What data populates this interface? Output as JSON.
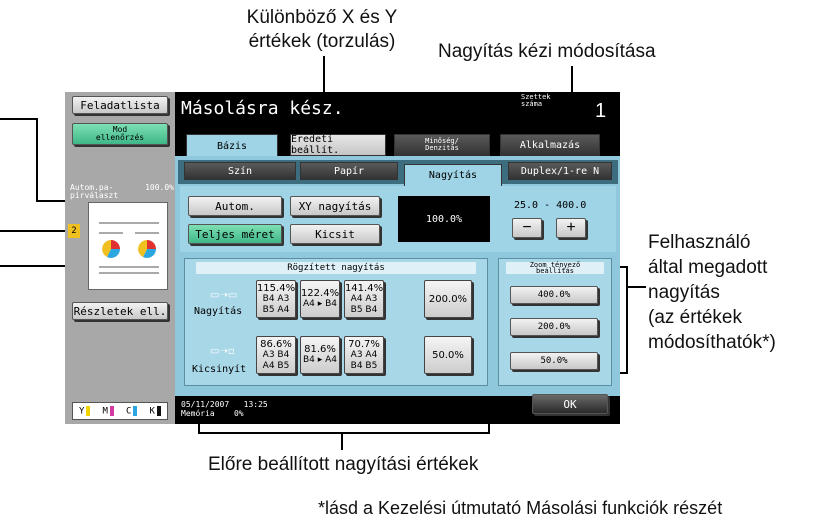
{
  "callouts": {
    "xy_line1": "Különböző X és Y",
    "xy_line2": "értékek (torzulás)",
    "manual": "Nagyítás kézi módosítása",
    "user_line1": "Felhasználó",
    "user_line2": "által megadott",
    "user_line3": "nagyítás",
    "user_line4": "(az értékek",
    "user_line5": "módosíthatók*)",
    "preset": "Előre beállított nagyítási értékek",
    "footnote": "*lásd a Kezelési útmutató Másolási funkciók részét"
  },
  "left": {
    "job_list": "Feladatlista",
    "check_l1": "Mod",
    "check_l2": "ellenőrzés",
    "auto_l1": "Autom.pa-",
    "auto_l2": "pírválaszt",
    "auto_zoom": "100.0%",
    "tray": "2",
    "details": "Részletek ell.",
    "toner": [
      "Y",
      "M",
      "C",
      "K"
    ],
    "toner_colors": [
      "#f2d200",
      "#d43aa6",
      "#2aa6e0",
      "#111111"
    ]
  },
  "header": {
    "status": "Másolásra kész.",
    "sets_l1": "Szettek",
    "sets_l2": "száma",
    "sets_value": "1"
  },
  "tabs": {
    "basic": "Bázis",
    "original": "Eredeti beállít.",
    "quality_l1": "Minőség/",
    "quality_l2": "Denzitás",
    "application": "Alkalmazás"
  },
  "subtabs": {
    "color": "Szín",
    "paper": "Papír",
    "zoom": "Nagyítás",
    "duplex": "Duplex/1-re N"
  },
  "zoom": {
    "auto": "Autom.",
    "xy": "XY nagyítás",
    "display": "100.0%",
    "range_min": "25.0",
    "range_sep": "-",
    "range_max": "400.0",
    "minus": "−",
    "plus": "+",
    "full_size": "Teljes méret",
    "minimal": "Kicsit"
  },
  "fixed": {
    "title": "Rögzített nagyítás",
    "enlarge_label": "Nagyítás",
    "reduce_label": "Kicsinyít",
    "enlarge": [
      {
        "pct": "115.4%",
        "p1": "B4 A3",
        "p2": "B5 A4"
      },
      {
        "pct": "122.4%",
        "p1": "A4 ▸ B4",
        "p2": ""
      },
      {
        "pct": "141.4%",
        "p1": "A4 A3",
        "p2": "B5 B4"
      }
    ],
    "enlarge_big": "200.0%",
    "reduce": [
      {
        "pct": "86.6%",
        "p1": "A3 B4",
        "p2": "A4 B5"
      },
      {
        "pct": "81.6%",
        "p1": "B4 ▸ A4",
        "p2": ""
      },
      {
        "pct": "70.7%",
        "p1": "A3 A4",
        "p2": "B4 B5"
      }
    ],
    "reduce_big": "50.0%"
  },
  "user_zoom": {
    "title_l1": "Zoom tényező",
    "title_l2": "beállítás",
    "values": [
      "400.0%",
      "200.0%",
      "50.0%"
    ]
  },
  "footer": {
    "date": "05/11/2007",
    "time": "13:25",
    "memory_label": "Memória",
    "memory_value": "0%",
    "ok": "OK"
  }
}
